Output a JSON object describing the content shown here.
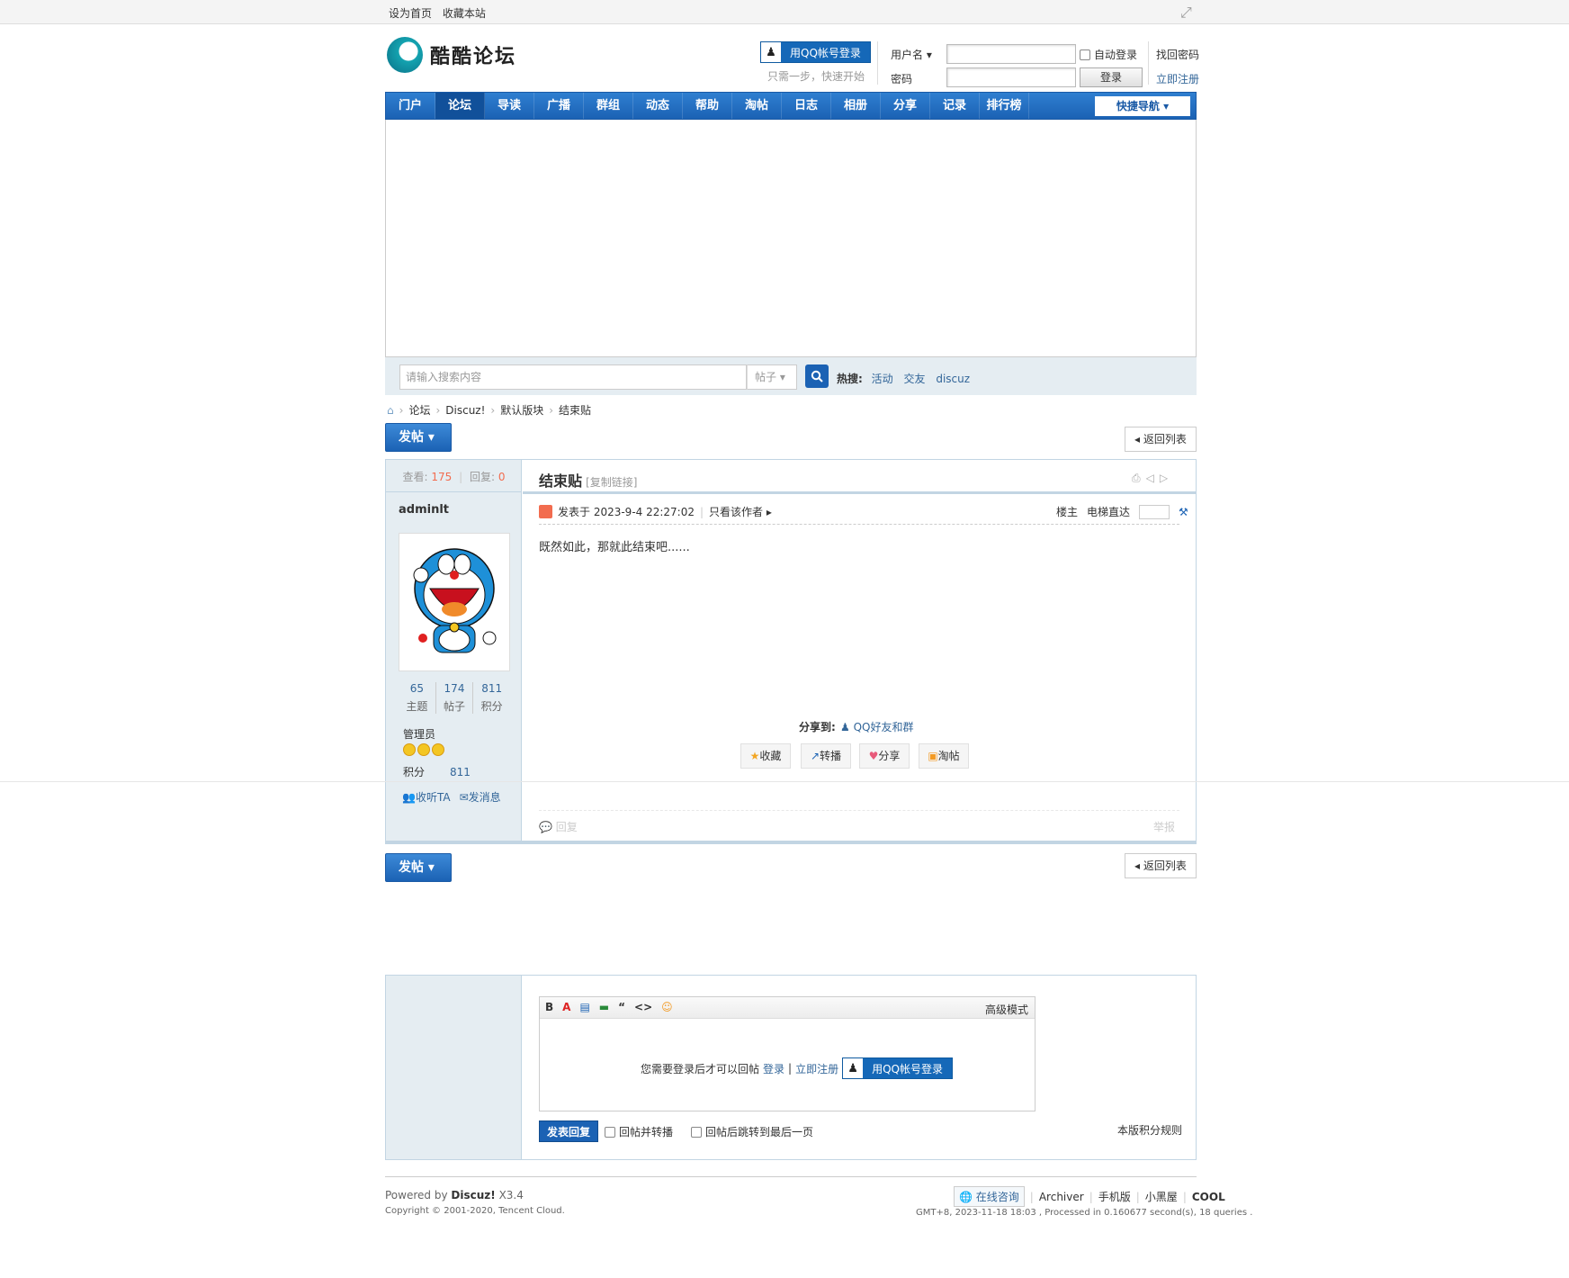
{
  "topbar": {
    "set_home": "设为首页",
    "bookmark": "收藏本站"
  },
  "header": {
    "site_name": "酷酷论坛",
    "qq_login": "用QQ帐号登录",
    "qq_tip": "只需一步，快速开始",
    "username_label": "用户名",
    "password_label": "密码",
    "auto_login": "自动登录",
    "login_button": "登录",
    "forgot_password": "找回密码",
    "register": "立即注册"
  },
  "nav": {
    "items": [
      "门户",
      "论坛",
      "导读",
      "广播",
      "群组",
      "动态",
      "帮助",
      "淘帖",
      "日志",
      "相册",
      "分享",
      "记录",
      "排行榜"
    ],
    "active_index": 1,
    "quick_nav": "快捷导航"
  },
  "search": {
    "placeholder": "请输入搜索内容",
    "type": "帖子",
    "hot_label": "热搜:",
    "hot_terms": [
      "活动",
      "交友",
      "discuz"
    ]
  },
  "breadcrumb": {
    "items": [
      "论坛",
      "Discuz!",
      "默认版块",
      "结束贴"
    ]
  },
  "buttons": {
    "new_post": "发帖",
    "back_to_list": "返回列表"
  },
  "thread": {
    "views_label": "查看:",
    "views": "175",
    "replies_label": "回复:",
    "replies": "0",
    "title": "结束贴",
    "copy_link": "[复制链接]",
    "posted_at": "发表于 2023-9-4 22:27:02",
    "author_only": "只看该作者",
    "floor_label": "楼主",
    "jump_label": "电梯直达",
    "content": "既然如此，那就此结束吧......",
    "share_label": "分享到:",
    "share_qq": "QQ好友和群",
    "actions": [
      "收藏",
      "转播",
      "分享",
      "淘帖"
    ],
    "reply_link": "回复",
    "report_link": "举报"
  },
  "author": {
    "name": "adminlt",
    "topics": "65",
    "topics_label": "主题",
    "posts": "174",
    "posts_label": "帖子",
    "credits": "811",
    "credits_label": "积分",
    "group": "管理员",
    "credit_line_label": "积分",
    "credit_line_value": "811",
    "follow": "收听TA",
    "message": "发消息"
  },
  "quick_reply": {
    "toolbar": [
      "B",
      "A",
      "▤",
      "▬",
      "“",
      "<>",
      "☺"
    ],
    "advanced_mode": "高级模式",
    "login_required": "您需要登录后才可以回帖",
    "login": "登录",
    "register": "立即注册",
    "qq_login": "用QQ帐号登录",
    "submit": "发表回复",
    "option_relay": "回帖并转播",
    "option_jump_last": "回帖后跳转到最后一页",
    "credit_rules": "本版积分规则"
  },
  "footer": {
    "powered_prefix": "Powered by",
    "powered_brand": "Discuz!",
    "powered_version": "X3.4",
    "copyright": "Copyright © 2001-2020, Tencent Cloud.",
    "consult": "在线咨询",
    "links": [
      "Archiver",
      "手机版",
      "小黑屋",
      "COOL"
    ],
    "meta": "GMT+8, 2023-11-18 18:03 , Processed in 0.160677 second(s), 18 queries ."
  }
}
